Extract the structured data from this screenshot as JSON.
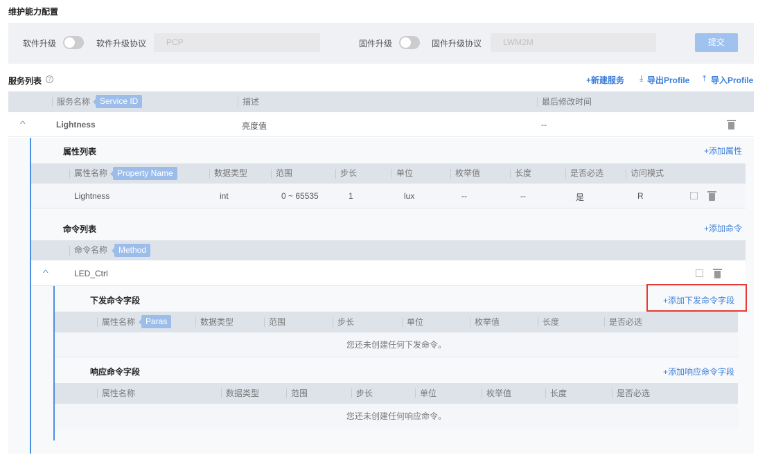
{
  "title": "维护能力配置",
  "config": {
    "sw_label": "软件升级",
    "sw_protocol_label": "软件升级协议",
    "sw_protocol": "PCP",
    "fw_label": "固件升级",
    "fw_protocol_label": "固件升级协议",
    "fw_protocol": "LWM2M",
    "submit": "提交",
    "sw_enabled": false,
    "fw_enabled": false
  },
  "services": {
    "title": "服务列表",
    "new": "+新建服务",
    "export": "导出Profile",
    "import": "导入Profile",
    "headers": [
      "服务名称",
      "描述",
      "最后修改时间"
    ],
    "tag": "Service ID",
    "row": {
      "name": "Lightness",
      "desc": "亮度值",
      "modified": "--"
    }
  },
  "properties": {
    "title": "属性列表",
    "add": "+添加属性",
    "tag": "Property Name",
    "headers": [
      "属性名称",
      "数据类型",
      "范围",
      "步长",
      "单位",
      "枚举值",
      "长度",
      "是否必选",
      "访问模式"
    ],
    "row": [
      "Lightness",
      "int",
      "0 ~ 65535",
      "1",
      "lux",
      "--",
      "--",
      "是",
      "R"
    ]
  },
  "commands": {
    "title": "命令列表",
    "add": "+添加命令",
    "header": "命令名称",
    "tag": "Method",
    "row": "LED_Ctrl",
    "down": {
      "title": "下发命令字段",
      "add": "+添加下发命令字段",
      "tag": "Paras",
      "headers": [
        "属性名称",
        "数据类型",
        "范围",
        "步长",
        "单位",
        "枚举值",
        "长度",
        "是否必选"
      ],
      "empty": "您还未创建任何下发命令。"
    },
    "resp": {
      "title": "响应命令字段",
      "add": "+添加响应命令字段",
      "headers": [
        "属性名称",
        "数据类型",
        "范围",
        "步长",
        "单位",
        "枚举值",
        "长度",
        "是否必选"
      ],
      "empty": "您还未创建任何响应命令。"
    }
  },
  "accent": "#3c7fd9",
  "highlight": "#e53935"
}
